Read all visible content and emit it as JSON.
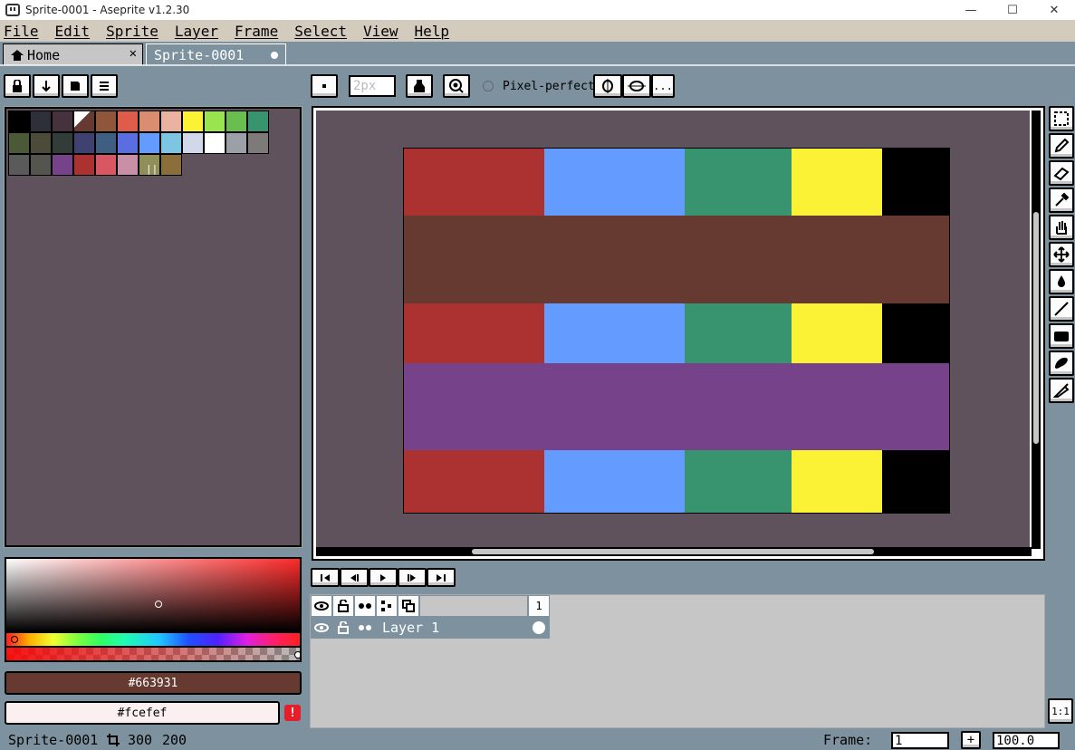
{
  "window": {
    "title": "Sprite-0001 - Aseprite v1.2.30",
    "minimize": "—",
    "maximize": "☐",
    "close": "✕"
  },
  "menu": [
    "File",
    "Edit",
    "Sprite",
    "Layer",
    "Frame",
    "Select",
    "View",
    "Help"
  ],
  "tabs": [
    {
      "label": "Home",
      "close": "✕"
    },
    {
      "label": "Sprite-0001"
    }
  ],
  "palette_buttons": [
    "lock-icon",
    "sort-icon",
    "save-icon",
    "menu-icon"
  ],
  "palette": [
    "#000000",
    "#222034",
    "#45283c",
    "#663931",
    "#8f563b",
    "#df7126",
    "#d9a066",
    "#eec39a",
    "#fbf236",
    "#99e550",
    "#6abe30",
    "#37946e",
    "#4b692f",
    "#524b24",
    "#323c39",
    "#3f3f74",
    "#306082",
    "#5b6ee1",
    "#639bff",
    "#5fcde4",
    "#cbdbfc",
    "#ffffff",
    "#9badb7",
    "#847e87",
    "#696a6a",
    "#595652",
    "#76428a",
    "#ac3232",
    "#d95763",
    "#d77bba",
    "#8f974a",
    "#8a6f30"
  ],
  "palette_display": [
    "#000000",
    "#2f2f39",
    "#45323c",
    "#663931",
    "#8f563b",
    "#df5b4a",
    "#db8d72",
    "#eab2a0",
    "#fbf236",
    "#99e550",
    "#6abe50",
    "#37946e",
    "#4b5a36",
    "#4b4b39",
    "#323c39",
    "#3f4270",
    "#3f5f82",
    "#5b6ee1",
    "#639bff",
    "#7cc5e4",
    "#d0d8ea",
    "#ffffff",
    "#9ba0a6",
    "#7e7a7a",
    "#5a5a5a",
    "#555550",
    "#76428a",
    "#ac3232",
    "#d95763",
    "#c98fa6",
    "#8f8f5a",
    "#8a6f3a"
  ],
  "foreground": {
    "hex": "#663931",
    "label": "#663931"
  },
  "background": {
    "hex": "#fcefef",
    "label": "#fcefef"
  },
  "warning_icon": "!",
  "context": {
    "brush_size": "2px",
    "pixel_perfect": "Pixel-perfect",
    "more": "..."
  },
  "tools": [
    "rect-select-icon",
    "pencil-icon",
    "eraser-icon",
    "eyedropper-icon",
    "hand-icon",
    "move-icon",
    "paint-bucket-icon",
    "line-icon",
    "rectangle-icon",
    "contour-icon",
    "blur-icon"
  ],
  "sprite_rows": [
    {
      "kind": "blocks",
      "colors": [
        "#ac3232",
        "#639bff",
        "#37946e",
        "#fbf236",
        "#000000"
      ]
    },
    {
      "kind": "band",
      "color": "#663931"
    },
    {
      "kind": "blocks",
      "colors": [
        "#ac3232",
        "#639bff",
        "#37946e",
        "#fbf236",
        "#000000"
      ]
    },
    {
      "kind": "band",
      "color": "#76428a"
    },
    {
      "kind": "blocks",
      "colors": [
        "#ac3232",
        "#639bff",
        "#37946e",
        "#fbf236",
        "#000000"
      ]
    }
  ],
  "timeline": {
    "frame_header": "1",
    "layer_name": "Layer 1",
    "zoom_fit": "1:1"
  },
  "status": {
    "sprite_name": "Sprite-0001",
    "width": "300",
    "height": "200",
    "frame_label": "Frame:",
    "frame_value": "1",
    "add_frame": "+",
    "zoom": "100.0"
  }
}
